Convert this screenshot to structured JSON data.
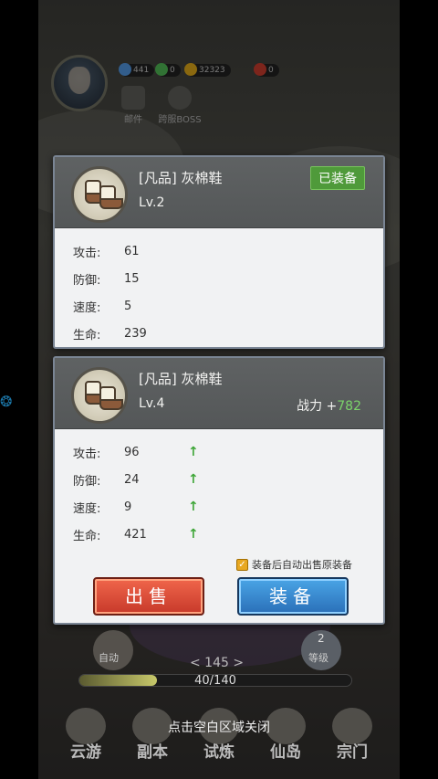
{
  "top_bar": {
    "resources": [
      {
        "icon": "gem-icon",
        "value": "441",
        "color": "#4d8fd6"
      },
      {
        "icon": "jade-icon",
        "value": "0",
        "color": "#4caf50"
      },
      {
        "icon": "gold-icon",
        "value": "32323",
        "color": "#d4a017"
      },
      {
        "icon": "ticket-icon",
        "value": "0",
        "color": "#c0392b"
      }
    ],
    "buttons": [
      {
        "icon": "mail-icon",
        "label": "邮件"
      },
      {
        "icon": "boss-icon",
        "label": "跨服BOSS"
      }
    ]
  },
  "equipped_item": {
    "icon": "cotton-boots-icon",
    "name": "[凡品] 灰棉鞋",
    "level": "Lv.2",
    "badge": "已装备",
    "stats": [
      {
        "label": "攻击:",
        "value": "61"
      },
      {
        "label": "防御:",
        "value": "15"
      },
      {
        "label": "速度:",
        "value": "5"
      },
      {
        "label": "生命:",
        "value": "239"
      }
    ]
  },
  "new_item": {
    "icon": "cotton-boots-icon",
    "name": "[凡品] 灰棉鞋",
    "level": "Lv.4",
    "power_label": "战力 +",
    "power_value": "782",
    "stats": [
      {
        "label": "攻击:",
        "value": "96",
        "trend": "up"
      },
      {
        "label": "防御:",
        "value": "24",
        "trend": "up"
      },
      {
        "label": "速度:",
        "value": "9",
        "trend": "up"
      },
      {
        "label": "生命:",
        "value": "421",
        "trend": "up"
      }
    ],
    "auto_sell_label": "装备后自动出售原装备",
    "auto_sell_checked": true,
    "sell_label": "出售",
    "equip_label": "装备"
  },
  "hud": {
    "auto_label": "自动",
    "level_num": "2",
    "level_label": "等级",
    "stage": "< 145 >",
    "progress_text": "40/140",
    "progress_fraction": 0.2857
  },
  "close_hint": "点击空白区域关闭",
  "nav": [
    {
      "icon": "cloud-travel-icon",
      "label": "云游"
    },
    {
      "icon": "dungeon-icon",
      "label": "副本"
    },
    {
      "icon": "trial-icon",
      "label": "试炼"
    },
    {
      "icon": "island-icon",
      "label": "仙岛"
    },
    {
      "icon": "sect-icon",
      "label": "宗门"
    }
  ]
}
